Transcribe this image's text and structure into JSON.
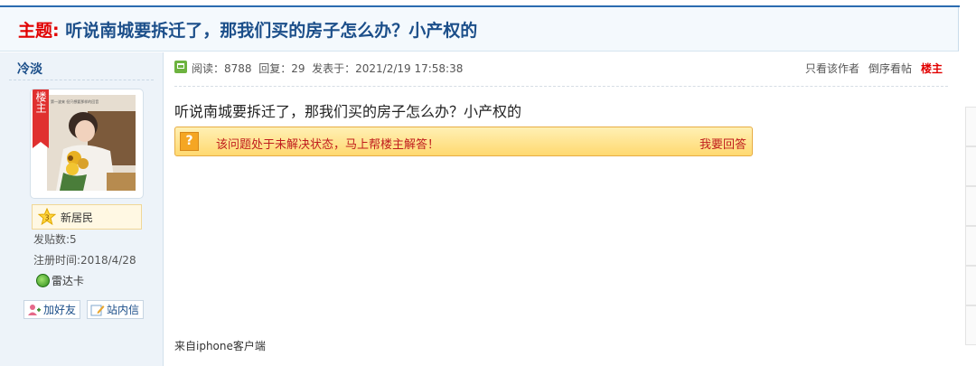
{
  "thread": {
    "title_prefix": "主题:",
    "title": "听说南城要拆迁了，那我们买的房子怎么办？小产权的"
  },
  "author": {
    "name": "冷淡",
    "badge": "楼主",
    "rank_level": "3",
    "rank_name": "新居民",
    "post_count": "发贴数:5",
    "register_time": "注册时间:2018/4/28",
    "radar": "雷达卡",
    "add_friend_label": "加好友",
    "message_label": "站内信",
    "avatar_caption": "第一波来 但只想要那样的回音"
  },
  "meta": {
    "reads": "阅读：8788",
    "replies": "回复：29",
    "posted": "发表于：2021/2/19 17:58:38",
    "only_author": "只看该作者",
    "reverse": "倒序看帖",
    "floor": "楼主"
  },
  "post": {
    "body": "听说南城要拆迁了，那我们买的房子怎么办？小产权的",
    "unsolved_text": "该问题处于未解决状态，马上帮楼主解答！",
    "answer_label": "我要回答",
    "source": "来自iphone客户端"
  },
  "colors": {
    "accent": "#1c4f8a",
    "highlight": "#e10000",
    "notice_bg": "#ffd970"
  }
}
